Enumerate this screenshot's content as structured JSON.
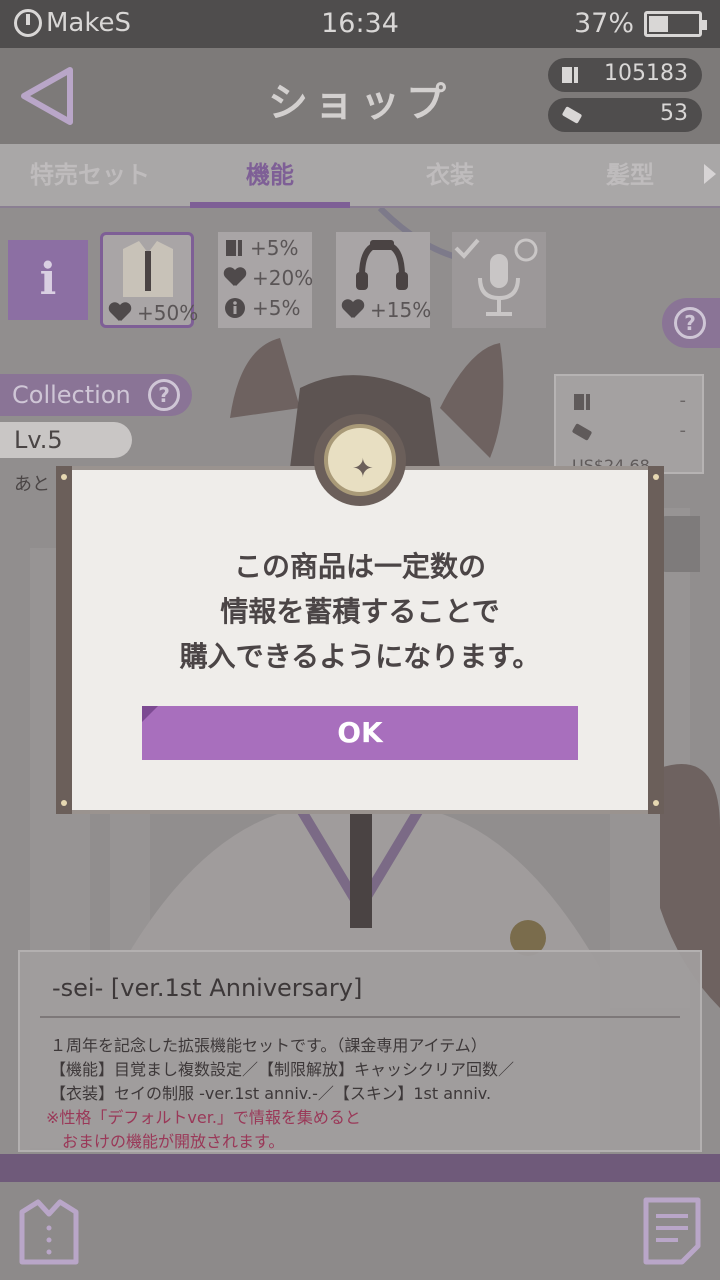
{
  "status_bar": {
    "carrier": "MakeS",
    "time": "16:34",
    "battery": "37%",
    "battery_level": 0.37
  },
  "header": {
    "title": "ショップ",
    "info_count": "105183",
    "ticket_count": "53"
  },
  "tabs": [
    {
      "label": "特売セット",
      "active": false
    },
    {
      "label": "機能",
      "active": true
    },
    {
      "label": "衣装",
      "active": false
    },
    {
      "label": "髪型",
      "active": false
    }
  ],
  "items": {
    "info_label": "i",
    "item1_bonus": "+50%",
    "item2_bonus_info": "+5%",
    "item2_bonus_heart": "+20%",
    "item2_bonus_i": "+5%",
    "item3_bonus": "+15%"
  },
  "collection": {
    "label": "Collection",
    "help": "?",
    "level": "Lv.5",
    "remaining": "あと"
  },
  "price": {
    "dash1": "-",
    "dash2": "-",
    "amount": "US$24.68"
  },
  "modal": {
    "message_line1": "この商品は一定数の",
    "message_line2": "情報を蓄積することで",
    "message_line3": "購入できるようになります。",
    "ok_label": "OK"
  },
  "description": {
    "title": "-sei- [ver.1st Anniversary]",
    "line1": "１周年を記念した拡張機能セットです。（課金専用アイテム）",
    "line2": "【機能】目覚まし複数設定／【制限解放】キャッシクリア回数／",
    "line3": "【衣装】セイの制服 -ver.1st anniv.-／【スキン】1st anniv.",
    "note1": "※性格「デフォルトver.」で情報を集めると",
    "note2": "　おまけの機能が開放されます。"
  },
  "colors": {
    "accent": "#a86fbd",
    "tab_active": "#7e5f96",
    "note": "#9a3858"
  }
}
